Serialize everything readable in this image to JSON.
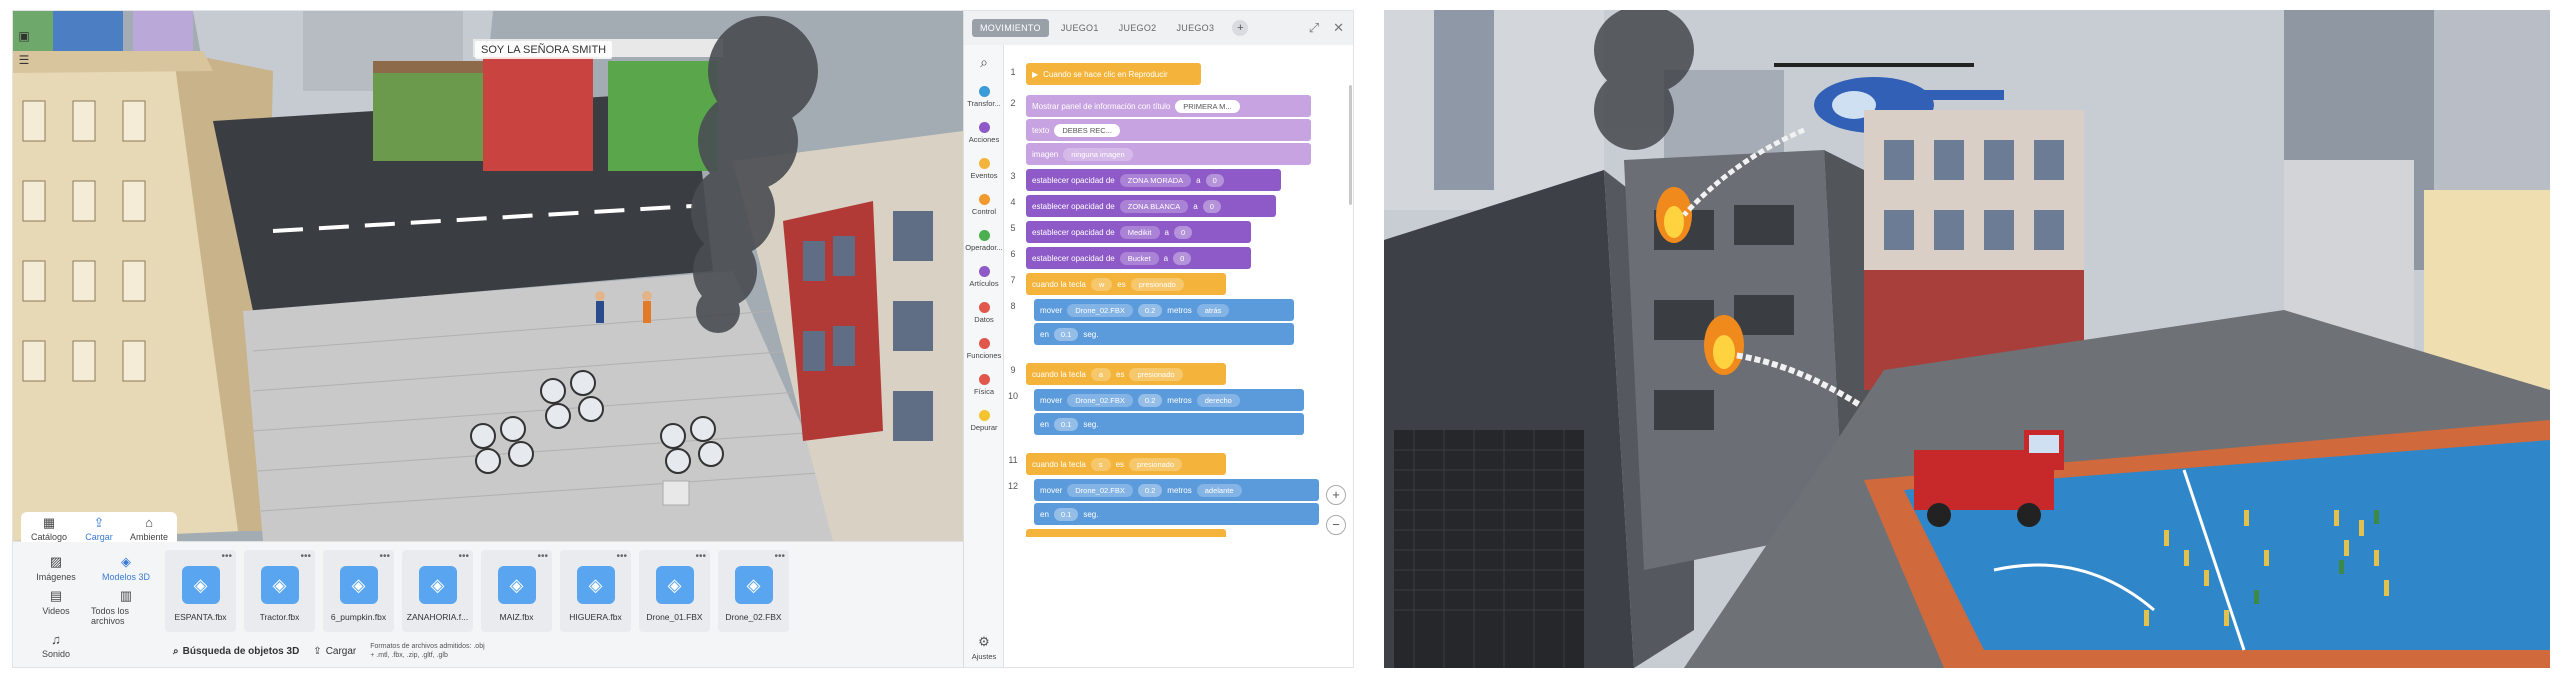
{
  "viewport": {
    "scene_label": "SOY LA SEÑORA SMITH"
  },
  "library": {
    "tabs": [
      {
        "label": "Catálogo",
        "icon": "catalog-icon"
      },
      {
        "label": "Cargar",
        "icon": "upload-icon"
      },
      {
        "label": "Ambiente",
        "icon": "environment-icon"
      }
    ],
    "categories": [
      {
        "label": "Imágenes",
        "icon": "image-icon"
      },
      {
        "label": "Modelos 3D",
        "icon": "cube-icon"
      },
      {
        "label": "Videos",
        "icon": "video-icon"
      },
      {
        "label": "Todos los archivos",
        "icon": "files-icon"
      },
      {
        "label": "Sonido",
        "icon": "sound-icon"
      }
    ],
    "files": [
      "ESPANTA.fbx",
      "Tractor.fbx",
      "6_pumpkin.fbx",
      "ZANAHORIA.f...",
      "MAIZ.fbx",
      "HIGUERA.fbx",
      "Drone_01.FBX",
      "Drone_02.FBX"
    ],
    "search_label": "Búsqueda de objetos 3D",
    "upload_label": "Cargar",
    "formats_text": "Formatos de archivos admitidos: .obj + .mtl, .fbx, .zip, .gltf, .glb"
  },
  "code": {
    "tabs": [
      "MOVIMIENTO",
      "JUEGO1",
      "JUEGO2",
      "JUEGO3"
    ],
    "categories": [
      {
        "label": "Transfor...",
        "color": "#3b9bd9"
      },
      {
        "label": "Acciones",
        "color": "#8e5ac8"
      },
      {
        "label": "Eventos",
        "color": "#f4b43b"
      },
      {
        "label": "Control",
        "color": "#f29a2e"
      },
      {
        "label": "Operador...",
        "color": "#4caf50"
      },
      {
        "label": "Artículos",
        "color": "#8e5ac8"
      },
      {
        "label": "Datos",
        "color": "#e2574c"
      },
      {
        "label": "Funciones",
        "color": "#e2574c"
      },
      {
        "label": "Física",
        "color": "#e2574c"
      },
      {
        "label": "Depurar",
        "color": "#f4c430"
      }
    ],
    "settings_label": "Ajustes",
    "line_numbers": [
      "1",
      "2",
      "3",
      "4",
      "5",
      "6",
      "7",
      "8",
      "9",
      "10",
      "11",
      "12"
    ],
    "blocks": {
      "b1": "Cuando se hace clic en Reproducir",
      "b2a": "Mostrar panel de información con título",
      "b2a_v": "PRIMERA M...",
      "b2b": "texto",
      "b2b_v": "DEBES REC...",
      "b2c": "imagen",
      "b2c_v": "ninguna imagen",
      "set_label": "establecer opacidad de",
      "a_label": "a",
      "zero": "0",
      "set_targets": [
        "ZONA MORADA",
        "ZONA BLANCA",
        "Medikit",
        "Bucket"
      ],
      "key_label": "cuando la tecla",
      "es_label": "es",
      "pressed": "presionado",
      "keys": [
        "w",
        "a",
        "s"
      ],
      "move_label": "mover",
      "object": "Drone_02.FBX",
      "amount": "0.2",
      "meters": "metros",
      "dirs": [
        "atrás",
        "derecho",
        "adelante"
      ],
      "in_label": "en",
      "time": "0.1",
      "seg": "seg."
    }
  }
}
